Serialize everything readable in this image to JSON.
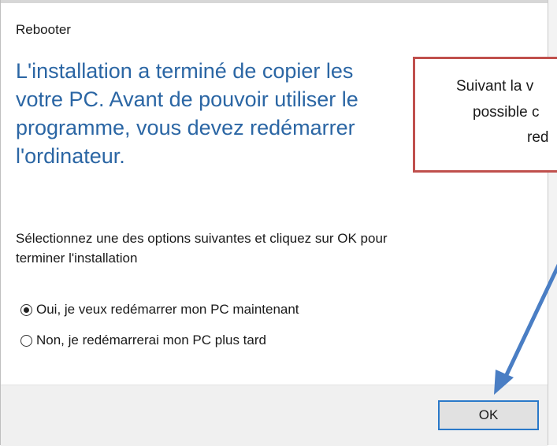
{
  "window": {
    "title": "Rebooter"
  },
  "headline": {
    "line1": "L'installation a terminé de copier les",
    "line2": "votre PC. Avant de pouvoir utiliser le",
    "line3": "programme, vous devez redémarrer",
    "line4": "l'ordinateur."
  },
  "instruction": {
    "line1": "Sélectionnez une des options suivantes et cliquez sur OK pour",
    "line2": "terminer l'installation"
  },
  "options": [
    {
      "label": "Oui, je veux redémarrer mon PC maintenant",
      "selected": true
    },
    {
      "label": "Non, je redémarrerai mon PC plus tard",
      "selected": false
    }
  ],
  "footer": {
    "ok_label": "OK"
  },
  "callout": {
    "line1": "Suivant la v",
    "line2": "possible c",
    "line3": "red"
  },
  "colors": {
    "headline": "#2b66a4",
    "callout_border": "#c0504d",
    "arrow": "#4a7ec4",
    "ok_border": "#2a79c9"
  }
}
